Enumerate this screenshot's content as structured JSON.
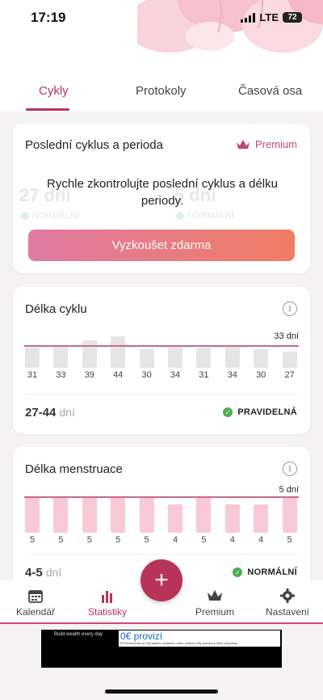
{
  "status_bar": {
    "time": "17:19",
    "network": "LTE",
    "battery": "72"
  },
  "tabs": [
    {
      "label": "Cykly",
      "active": true
    },
    {
      "label": "Protokoly",
      "active": false
    },
    {
      "label": "Časová osa",
      "active": false
    }
  ],
  "last_cycle": {
    "title": "Poslední cyklus a perioda",
    "premium_label": "Premium",
    "locked_text": "Rychle zkontrolujte poslední cyklus a délku periody.",
    "button_label": "Vyzkoušet zdarma",
    "ghost_left_value": "27 dní",
    "ghost_left_status": "NORMÁLNÍ",
    "ghost_right_value": "5 dní",
    "ghost_right_status": "NORMÁLNÍ"
  },
  "cycle_length": {
    "title": "Délka cyklu",
    "info_icon": "i",
    "reference_label": "33 dní",
    "range_value": "27-44",
    "range_unit": "dní",
    "status": "PRAVIDELNÁ"
  },
  "period_length": {
    "title": "Délka menstruace",
    "info_icon": "i",
    "reference_label": "5 dní",
    "range_value": "4-5",
    "range_unit": "dní",
    "status": "NORMÁLNÍ"
  },
  "chart_data": [
    {
      "type": "bar",
      "categories": [
        "31",
        "33",
        "39",
        "44",
        "30",
        "34",
        "31",
        "34",
        "30",
        "27"
      ],
      "values": [
        31,
        33,
        39,
        44,
        30,
        34,
        31,
        34,
        30,
        27
      ],
      "reference_value": 33,
      "reference_label": "33 dní",
      "bar_color": "#e5e5e5"
    },
    {
      "type": "bar",
      "categories": [
        "5",
        "5",
        "5",
        "5",
        "5",
        "4",
        "5",
        "4",
        "4",
        "5"
      ],
      "values": [
        5,
        5,
        5,
        5,
        5,
        4,
        5,
        4,
        4,
        5
      ],
      "reference_value": 5,
      "reference_label": "5 dní",
      "bar_color": "#f8c9d6"
    }
  ],
  "fab_label": "+",
  "bottom_nav": [
    {
      "label": "Kalendář",
      "icon": "calendar-icon",
      "active": false
    },
    {
      "label": "Statistiky",
      "icon": "bar-chart-icon",
      "active": true
    },
    {
      "label": "Premium",
      "icon": "crown-icon",
      "active": false
    },
    {
      "label": "Nastavení",
      "icon": "gear-icon",
      "active": false
    }
  ],
  "ad": {
    "title": "Build wealth every day",
    "headline": "0€ provizí",
    "disclaimer": "Při investování je tvůj kapitál vystaven riziku, kolikou tvůj výnosový dokíř peopleky."
  },
  "colors": {
    "accent": "#b8335a",
    "button_gradient_start": "#df7aa3",
    "button_gradient_end": "#ef7c63",
    "check_green": "#4caf50"
  }
}
